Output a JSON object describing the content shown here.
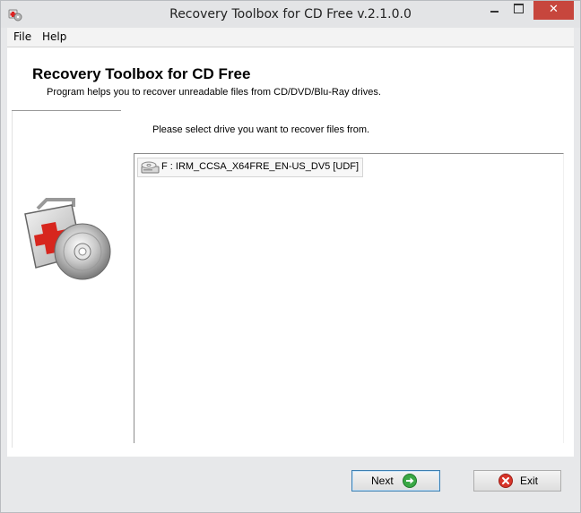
{
  "window": {
    "title": "Recovery Toolbox for CD Free v.2.1.0.0",
    "close_glyph": "✕"
  },
  "menu": [
    "File",
    "Help"
  ],
  "header": {
    "title": "Recovery Toolbox for CD Free",
    "subtitle": "Program helps you to recover unreadable files from CD/DVD/Blu-Ray drives."
  },
  "instruction": "Please select drive you want to recover files from.",
  "drives": [
    {
      "label": "F : IRM_CCSA_X64FRE_EN-US_DV5 [UDF]",
      "icon": "cd-drive-icon"
    }
  ],
  "buttons": {
    "next": "Next",
    "exit": "Exit"
  },
  "colors": {
    "close_button": "#c7463d",
    "next_icon": "#3aa845",
    "exit_icon": "#d8352a"
  }
}
